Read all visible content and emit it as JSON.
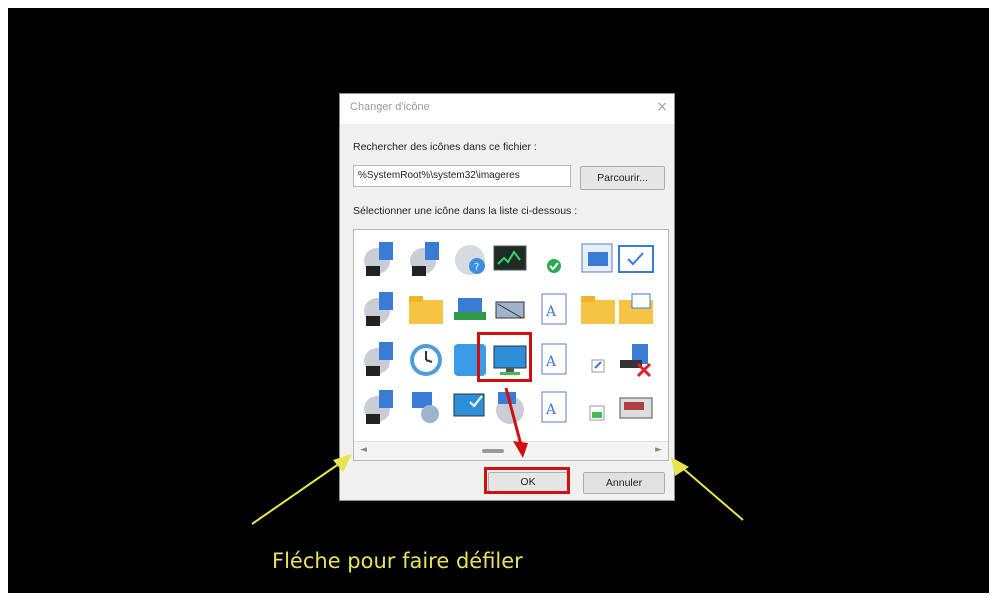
{
  "dialog": {
    "title": "Changer d'icône",
    "close_glyph": "×",
    "search_label": "Rechercher des icônes dans ce fichier :",
    "path_value": "%SystemRoot%\\system32\\imageres",
    "browse_label": "Parcourir...",
    "select_label": "Sélectionner une icône dans la liste ci-dessous :",
    "ok_label": "OK",
    "cancel_label": "Annuler",
    "scroll_left_glyph": "◄",
    "scroll_right_glyph": "►"
  },
  "icons": [
    [
      "drive-icon",
      "drive-icon",
      "help-disc-icon",
      "performance-monitor-icon",
      "checkmark-icon",
      "window-icon",
      "checkbox-icon",
      "scrollbar-edge-icon"
    ],
    [
      "drive-icon",
      "folder-icon",
      "network-icon",
      "printer-icon",
      "font-icon",
      "folder-icon",
      "folder-checked-icon",
      "arrow-right-icon"
    ],
    [
      "drive-icon",
      "clock-icon",
      "blue-tile-icon",
      "monitor-icon",
      "font-icon",
      "shortcut-icon",
      "delete-drive-icon",
      "partial-icon"
    ],
    [
      "drive-icon",
      "network-drive-icon",
      "monitor-check-icon",
      "disk-cleanup-icon",
      "font-icon",
      "image-icon",
      "scanner-icon",
      "partial-icon"
    ]
  ],
  "annotation": {
    "caption": "Fléche pour faire défiler",
    "arrow_color": "#e8e44e",
    "highlight_color": "#d10f0f"
  }
}
